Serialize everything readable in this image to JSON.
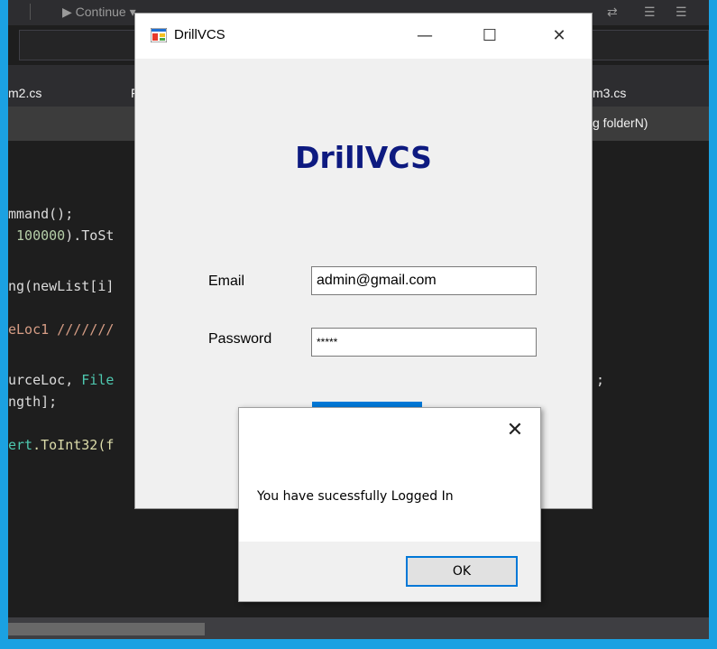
{
  "ide": {
    "toolbar_continue": "Continue",
    "tabs": [
      "m2.cs",
      "F",
      "m3.cs"
    ],
    "navbar_right": "g folderN)",
    "code": {
      "l1": "mmand();",
      "l2_num": " 100000",
      "l2_rest": ").ToSt",
      "l3": "ng(newList[i]",
      "l4": "eLoc1 ///////",
      "l5a": "urceLoc, ",
      "l5b": "File",
      "l6": "ngth];",
      "l7a": "ert",
      "l7b": ".ToInt32(f",
      "extra": ";"
    }
  },
  "form": {
    "window_title": "DrillVCS",
    "heading": "DrillVCS",
    "email_label": "Email",
    "email_value": "admin@gmail.com",
    "password_label": "Password",
    "password_value": "*****",
    "minimize": "—",
    "maximize": "☐",
    "close": "✕"
  },
  "msgbox": {
    "close": "✕",
    "message": "You have sucessfully Logged In",
    "ok_label": "OK"
  },
  "colors": {
    "accent": "#1ba1e2",
    "heading": "#0d1a80",
    "button_blue": "#0078d7"
  }
}
